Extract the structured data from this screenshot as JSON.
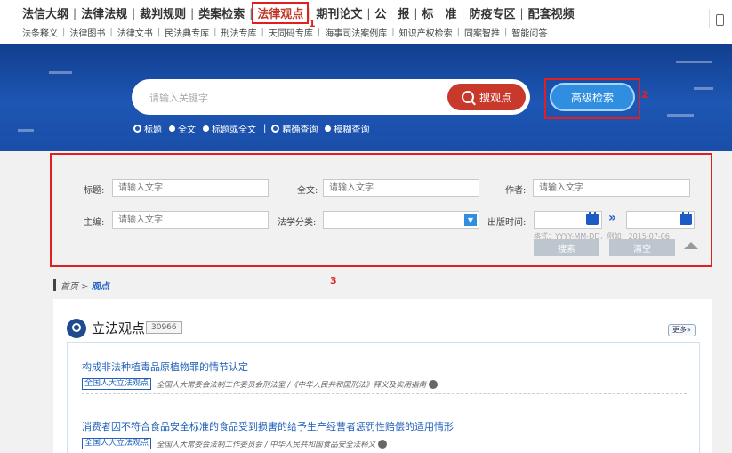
{
  "nav": {
    "main": [
      "法信大纲",
      "法律法规",
      "裁判规则",
      "类案检索",
      "法律观点",
      "期刊论文",
      "公　报",
      "标　准",
      "防疫专区",
      "配套视频"
    ],
    "active_index": 4,
    "sub": [
      "法条释义",
      "法律图书",
      "法律文书",
      "民法典专库",
      "刑法专库",
      "天同码专库",
      "海事司法案例库",
      "知识产权检索",
      "同案智推",
      "智能问答"
    ]
  },
  "annotations": {
    "a1": "1",
    "a2": "2",
    "a3": "3"
  },
  "search": {
    "placeholder": "请输入关键字",
    "button": "搜观点",
    "advanced": "高级检索",
    "scope_options": [
      "标题",
      "全文",
      "标题或全文"
    ],
    "match_options": [
      "精确查询",
      "模糊查询"
    ]
  },
  "advanced": {
    "title_label": "标题:",
    "fulltext_label": "全文:",
    "author_label": "作者:",
    "editor_label": "主编:",
    "category_label": "法学分类:",
    "date_label": "出版时间:",
    "input_placeholder": "请输入文字",
    "date_hint": "格式：YYYY-MM-DD，例如：2015-07-06",
    "search_btn": "搜索",
    "clear_btn": "清空"
  },
  "breadcrumb": {
    "home": "首页",
    "sep": " > ",
    "current": "观点"
  },
  "section": {
    "title": "立法观点",
    "count": "30966",
    "more": "更多»",
    "items": [
      {
        "title": "构成非法种植毒品原植物罪的情节认定",
        "tag": "全国人大立法观点",
        "source": "全国人大常委会法制工作委员会刑法室 /《中华人民共和国刑法》释义及实用指南"
      },
      {
        "title": "消费者因不符合食品安全标准的食品受到损害的给予生产经营者惩罚性赔偿的适用情形",
        "tag": "全国人大立法观点",
        "source": "全国人大常委会法制工作委员会 / 中华人民共和国食品安全法释义"
      }
    ]
  },
  "colors": {
    "accent_red": "#e02020",
    "brand_blue": "#1d56b4",
    "search_red": "#c9392b"
  }
}
